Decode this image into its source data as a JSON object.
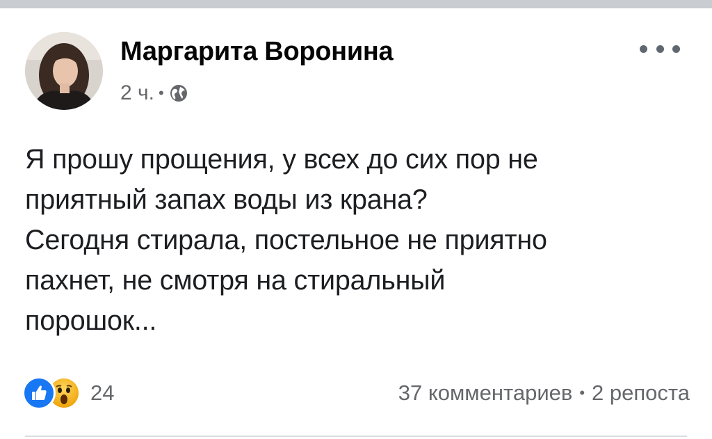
{
  "post": {
    "author": "Маргарита Воронина",
    "time": "2 ч.",
    "separator": "•",
    "audience_icon": "globe-icon",
    "more_icon": "more-horizontal-icon",
    "text": "Я прошу прощения, у всех до сих пор не\nприятный запах воды из крана?\nСегодня стирала, постельное не приятно\nпахнет, не смотря на стиральный\nпорошок...",
    "reactions": {
      "icons": [
        "like-reaction-icon",
        "wow-reaction-icon"
      ],
      "count": "24"
    },
    "comments": "37 комментариев",
    "stats_separator": "•",
    "shares": "2 репоста"
  },
  "colors": {
    "like_blue": "#1877f2",
    "wow_yellow": "#f7b125",
    "secondary_text": "#65676b"
  }
}
